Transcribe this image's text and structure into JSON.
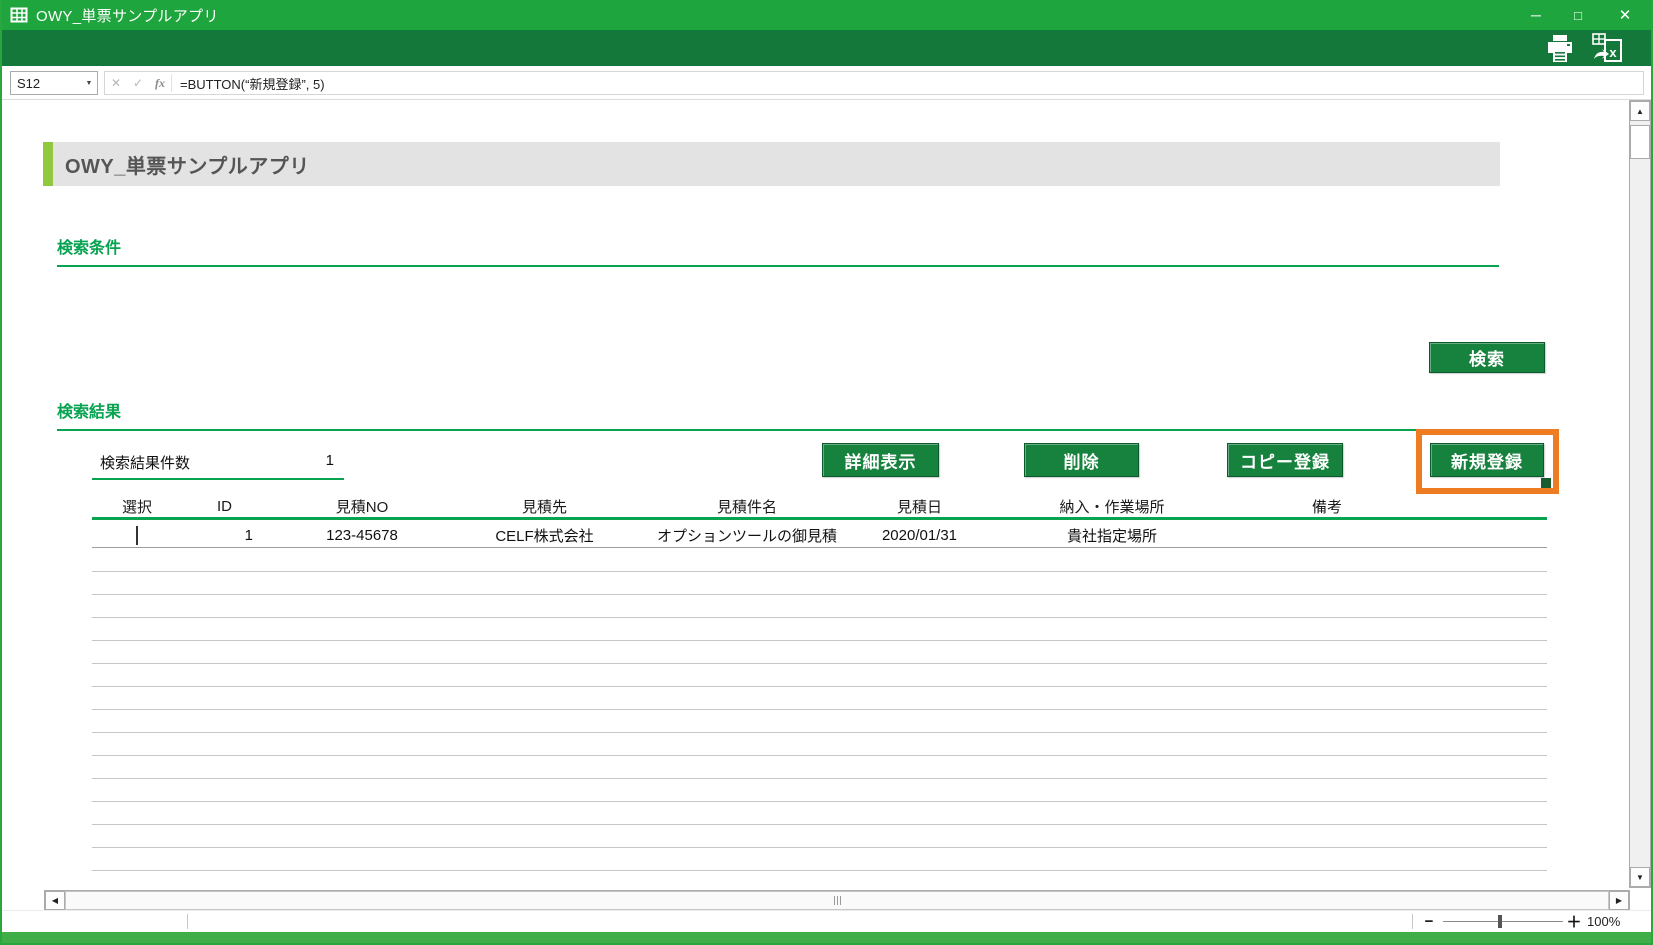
{
  "colors": {
    "titlebar_green": "#1FA53D",
    "toolbar_green": "#14783A",
    "button_green": "#17823E",
    "button_border": "#0A5A2B",
    "heading_green": "#07A351",
    "accent_lime": "#90C83F",
    "banner_gray": "#E3E3E3",
    "banner_text": "#555555",
    "selection_orange": "#EE7C22",
    "selection_handle": "#175C2F",
    "bottom_strip": "#3FAE49",
    "window_border": "#2AA63E",
    "row_line": "#C6C6C6",
    "table_line_dark": "#9E9E9E"
  },
  "window": {
    "title": "OWY_単票サンプルアプリ",
    "controls": [
      {
        "name": "minimize",
        "glyph": "─"
      },
      {
        "name": "maximize",
        "glyph": "□"
      },
      {
        "name": "close",
        "glyph": "✕"
      }
    ]
  },
  "formula_bar": {
    "cell_ref": "S12",
    "dropdown_glyph": "▼",
    "cancel_glyph": "✕",
    "confirm_glyph": "✓",
    "function_glyph": "fx",
    "formula": "=BUTTON(“新規登録”, 5)"
  },
  "scrollbars": {
    "up": "▲",
    "down": "▼",
    "left": "◀",
    "right": "▶"
  },
  "page": {
    "title": "OWY_単票サンプルアプリ",
    "section_search": "検索条件",
    "section_results": "検索結果",
    "search_button_label": "検索",
    "result_count_label": "検索結果件数",
    "result_count_value": "1",
    "action_buttons": [
      {
        "label": "詳細表示",
        "selected": false
      },
      {
        "label": "削除",
        "selected": false
      },
      {
        "label": "コピー登録",
        "selected": false
      },
      {
        "label": "新規登録",
        "selected": true
      }
    ],
    "table": {
      "columns": [
        "選択",
        "ID",
        "見積NO",
        "見積先",
        "見積件名",
        "見積日",
        "納入・作業場所",
        "備考"
      ],
      "rows": [
        {
          "checked": false,
          "id": "1",
          "quote_no": "123-45678",
          "customer": "CELF株式会社",
          "subject": "オプションツールの御見積",
          "date": "2020/01/31",
          "place": "貴社指定場所",
          "note": ""
        }
      ],
      "empty_row_count": 14
    }
  },
  "status_bar": {
    "zoom_out": "−",
    "zoom_in": "＋",
    "zoom_level": "100%"
  }
}
